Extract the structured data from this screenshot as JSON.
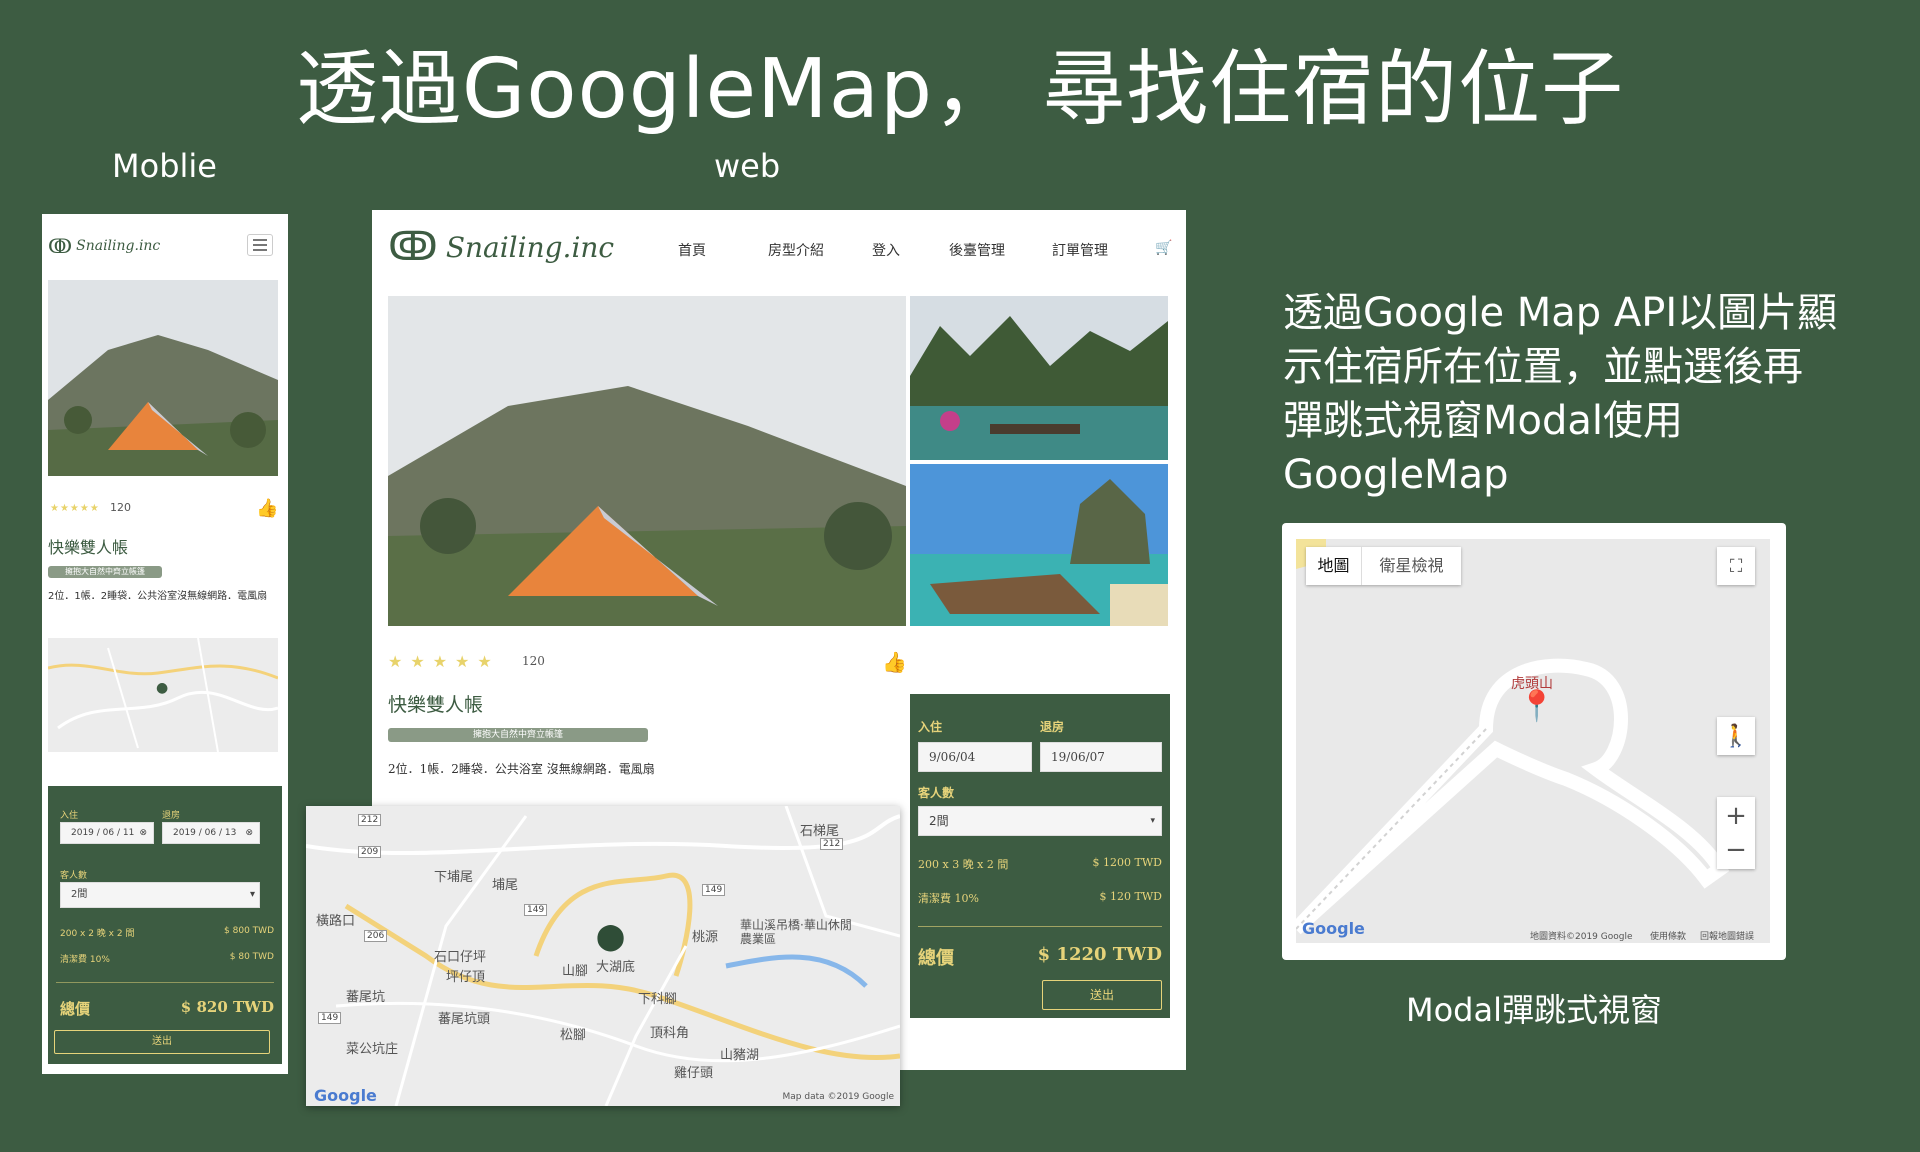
{
  "title": "透過GoogleMap， 尋找住宿的位子",
  "labels": {
    "mobile": "Moblie",
    "web": "web"
  },
  "description": [
    "透過Google Map API以圖片顯",
    "示住宿所在位置，並點選後再",
    "彈跳式視窗Modal使用GoogleMap"
  ],
  "modal_caption": "Modal彈跳式視窗",
  "brand": "Snailing.inc",
  "nav": [
    "首頁",
    "房型介紹",
    "登入",
    "後臺管理",
    "訂單管理"
  ],
  "product": {
    "rating_count": "120",
    "name": "快樂雙人帳",
    "tag": "擁抱大自然中齊立帳篷",
    "features_mobile": "2位．1帳．2睡袋．公共浴室沒無線網路．電風扇",
    "features_web": "2位．1帳．2睡袋．公共浴室 沒無線網路．電風扇"
  },
  "mobile_booking": {
    "checkin_label": "入住",
    "checkout_label": "退房",
    "checkin": "2019 / 06 / 11",
    "checkout": "2019 / 06 / 13",
    "guests_label": "客人數",
    "guests": "2間",
    "line1_label": "200 x 2 晚 x 2 間",
    "line1_value": "$ 800 TWD",
    "line2_label": "清潔費 10%",
    "line2_value": "$ 80 TWD",
    "total_label": "總價",
    "total_value": "$ 820 TWD",
    "submit": "送出"
  },
  "web_booking": {
    "checkin_label": "入住",
    "checkout_label": "退房",
    "checkin": "9/06/04",
    "checkout": "19/06/07",
    "guests_label": "客人數",
    "guests": "2間",
    "line1_label": "200 x 3 晚 x 2 間",
    "line1_value": "$ 1200 TWD",
    "line2_label": "清潔費 10%",
    "line2_value": "$ 120 TWD",
    "total_label": "總價",
    "total_value": "$ 1220 TWD",
    "submit": "送出"
  },
  "map": {
    "places": [
      "石梯尾",
      "下埔尾",
      "埔尾",
      "橫路口",
      "桃源",
      "華山溪吊橋·華山休閒農業區",
      "石口仔坪",
      "坪仔頂",
      "山腳",
      "大湖底",
      "下科腳",
      "蕃尾坑",
      "蕃尾坑頭",
      "頂科角",
      "松腳",
      "菜公坑庄",
      "山豬湖",
      "雞仔頭"
    ],
    "road_badges": [
      "212",
      "209",
      "212",
      "149",
      "149",
      "206",
      "149"
    ],
    "google": "Google",
    "attribution": "Map data ©2019 Google"
  },
  "modal_map": {
    "tab_map": "地圖",
    "tab_satellite": "衛星檢視",
    "place": "虎頭山",
    "google": "Google",
    "footer": [
      "地圖資料©2019 Google",
      "使用條款",
      "回報地圖錯誤"
    ]
  },
  "colors": {
    "bg": "#3d5c42",
    "gold": "#e6d37a",
    "tag": "#8a9a86",
    "heart": "#c8333a"
  }
}
